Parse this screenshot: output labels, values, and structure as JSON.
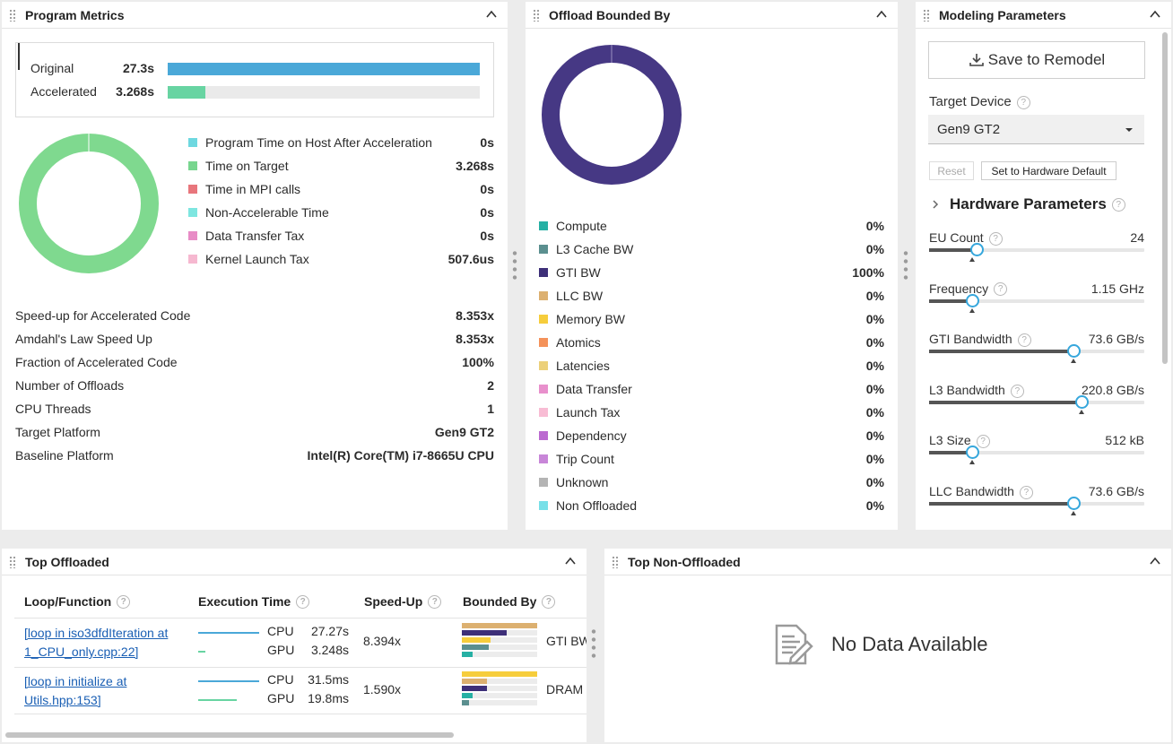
{
  "program_metrics": {
    "title": "Program Metrics",
    "compare": [
      {
        "label": "Original",
        "value": "27.3s",
        "fraction": 1.0,
        "color": "#4aa8d8"
      },
      {
        "label": "Accelerated",
        "value": "3.268s",
        "fraction": 0.12,
        "color": "#68d4a2"
      }
    ],
    "legend": [
      {
        "label": "Program Time on Host After Acceleration",
        "value": "0s",
        "color": "#6ed8e0"
      },
      {
        "label": "Time on Target",
        "value": "3.268s",
        "color": "#78d68f"
      },
      {
        "label": "Time in MPI calls",
        "value": "0s",
        "color": "#e8767c"
      },
      {
        "label": "Non-Accelerable Time",
        "value": "0s",
        "color": "#7ee6e0"
      },
      {
        "label": "Data Transfer Tax",
        "value": "0s",
        "color": "#e88cc6"
      },
      {
        "label": "Kernel Launch Tax",
        "value": "507.6us",
        "color": "#f6b8d0"
      }
    ],
    "donut_color": "#7fd98f",
    "stats": [
      {
        "label": "Speed-up for Accelerated Code",
        "value": "8.353x"
      },
      {
        "label": "Amdahl's Law Speed Up",
        "value": "8.353x"
      },
      {
        "label": "Fraction of Accelerated Code",
        "value": "100%"
      },
      {
        "label": "Number of Offloads",
        "value": "2"
      },
      {
        "label": "CPU Threads",
        "value": "1"
      },
      {
        "label": "Target Platform",
        "value": "Gen9 GT2"
      },
      {
        "label": "Baseline Platform",
        "value": "Intel(R) Core(TM) i7-8665U CPU"
      }
    ]
  },
  "offload_bounded": {
    "title": "Offload Bounded By",
    "donut_color": "#463884",
    "items": [
      {
        "label": "Compute",
        "value": "0%",
        "color": "#26b0a4"
      },
      {
        "label": "L3 Cache BW",
        "value": "0%",
        "color": "#5b8f8f"
      },
      {
        "label": "GTI BW",
        "value": "100%",
        "color": "#3d2f78"
      },
      {
        "label": "LLC BW",
        "value": "0%",
        "color": "#dcb070"
      },
      {
        "label": "Memory BW",
        "value": "0%",
        "color": "#f6cd3c"
      },
      {
        "label": "Atomics",
        "value": "0%",
        "color": "#f4925a"
      },
      {
        "label": "Latencies",
        "value": "0%",
        "color": "#ecd07a"
      },
      {
        "label": "Data Transfer",
        "value": "0%",
        "color": "#e890cc"
      },
      {
        "label": "Launch Tax",
        "value": "0%",
        "color": "#f8bcd4"
      },
      {
        "label": "Dependency",
        "value": "0%",
        "color": "#bb6ad0"
      },
      {
        "label": "Trip Count",
        "value": "0%",
        "color": "#c886d8"
      },
      {
        "label": "Unknown",
        "value": "0%",
        "color": "#b4b4b4"
      },
      {
        "label": "Non Offloaded",
        "value": "0%",
        "color": "#78e0e8"
      }
    ]
  },
  "modeling": {
    "title": "Modeling Parameters",
    "save_label": "Save to Remodel",
    "target_device_label": "Target Device",
    "target_device_value": "Gen9 GT2",
    "reset_label": "Reset",
    "hw_default_label": "Set to Hardware Default",
    "hw_params_label": "Hardware Parameters",
    "sliders": [
      {
        "label": "EU Count",
        "value": "24",
        "level": 0.22,
        "default": 0.2
      },
      {
        "label": "Frequency",
        "value": "1.15 GHz",
        "level": 0.2,
        "default": 0.2
      },
      {
        "label": "GTI Bandwidth",
        "value": "73.6 GB/s",
        "level": 0.67,
        "default": 0.67
      },
      {
        "label": "L3 Bandwidth",
        "value": "220.8 GB/s",
        "level": 0.71,
        "default": 0.71
      },
      {
        "label": "L3 Size",
        "value": "512 kB",
        "level": 0.2,
        "default": 0.2
      },
      {
        "label": "LLC Bandwidth",
        "value": "73.6 GB/s",
        "level": 0.67,
        "default": 0.67
      }
    ]
  },
  "top_offloaded": {
    "title": "Top Offloaded",
    "headers": [
      "Loop/Function",
      "Execution Time",
      "Speed-Up",
      "Bounded By"
    ],
    "rows": [
      {
        "fn_line1": "[loop in iso3dfdIteration at",
        "fn_line2": "1_CPU_only.cpp:22]",
        "cpu_label": "CPU",
        "cpu_time": "27.27s",
        "cpu_frac": 1.0,
        "gpu_label": "GPU",
        "gpu_time": "3.248s",
        "gpu_frac": 0.12,
        "speedup": "8.394x",
        "bounded": "GTI BW",
        "bars": [
          {
            "color": "#dcb070",
            "frac": 1.0
          },
          {
            "color": "#3d2f78",
            "frac": 0.6
          },
          {
            "color": "#f6cd3c",
            "frac": 0.38
          },
          {
            "color": "#5b8f8f",
            "frac": 0.36
          },
          {
            "color": "#26b0a4",
            "frac": 0.14
          }
        ]
      },
      {
        "fn_line1": "[loop in initialize at",
        "fn_line2": "Utils.hpp:153]",
        "cpu_label": "CPU",
        "cpu_time": "31.5ms",
        "cpu_frac": 1.0,
        "gpu_label": "GPU",
        "gpu_time": "19.8ms",
        "gpu_frac": 0.63,
        "speedup": "1.590x",
        "bounded": "DRAM",
        "bars": [
          {
            "color": "#f6cd3c",
            "frac": 1.0
          },
          {
            "color": "#dcb070",
            "frac": 0.33
          },
          {
            "color": "#3d2f78",
            "frac": 0.33
          },
          {
            "color": "#26b0a4",
            "frac": 0.14
          },
          {
            "color": "#5b8f8f",
            "frac": 0.1
          }
        ]
      }
    ]
  },
  "top_non_offloaded": {
    "title": "Top Non-Offloaded",
    "empty_text": "No Data Available"
  }
}
